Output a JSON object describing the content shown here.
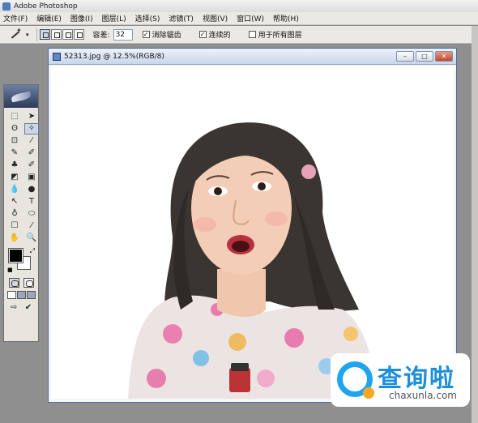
{
  "app": {
    "title": "Adobe Photoshop"
  },
  "menu": [
    "文件(F)",
    "编辑(E)",
    "图像(I)",
    "图层(L)",
    "选择(S)",
    "滤镜(T)",
    "视图(V)",
    "窗口(W)",
    "帮助(H)"
  ],
  "options": {
    "tolerance_label": "容差:",
    "tolerance_value": "32",
    "antialias_label": "消除锯齿",
    "antialias_checked": true,
    "contiguous_label": "连续的",
    "contiguous_checked": true,
    "all_layers_label": "用于所有图层",
    "all_layers_checked": false
  },
  "document": {
    "title": "52313.jpg @ 12.5%(RGB/8)"
  },
  "toolbox": {
    "tools": [
      "⬚",
      "➤",
      "ʘ",
      "✧",
      "⊡",
      "⁄",
      "✎",
      "✐",
      "♣",
      "✐",
      "◩",
      "▣",
      "💧",
      "●",
      "↖",
      "T",
      "♁",
      "⬭",
      "☐",
      "⁄",
      "✋",
      "🔍"
    ],
    "foreground_color": "#000000",
    "background_color": "#ffffff"
  },
  "watermark": {
    "cn": "查询啦",
    "en": "chaxunla.com",
    "brand_color": "#1fa5ee",
    "accent_color": "#f5a623"
  }
}
